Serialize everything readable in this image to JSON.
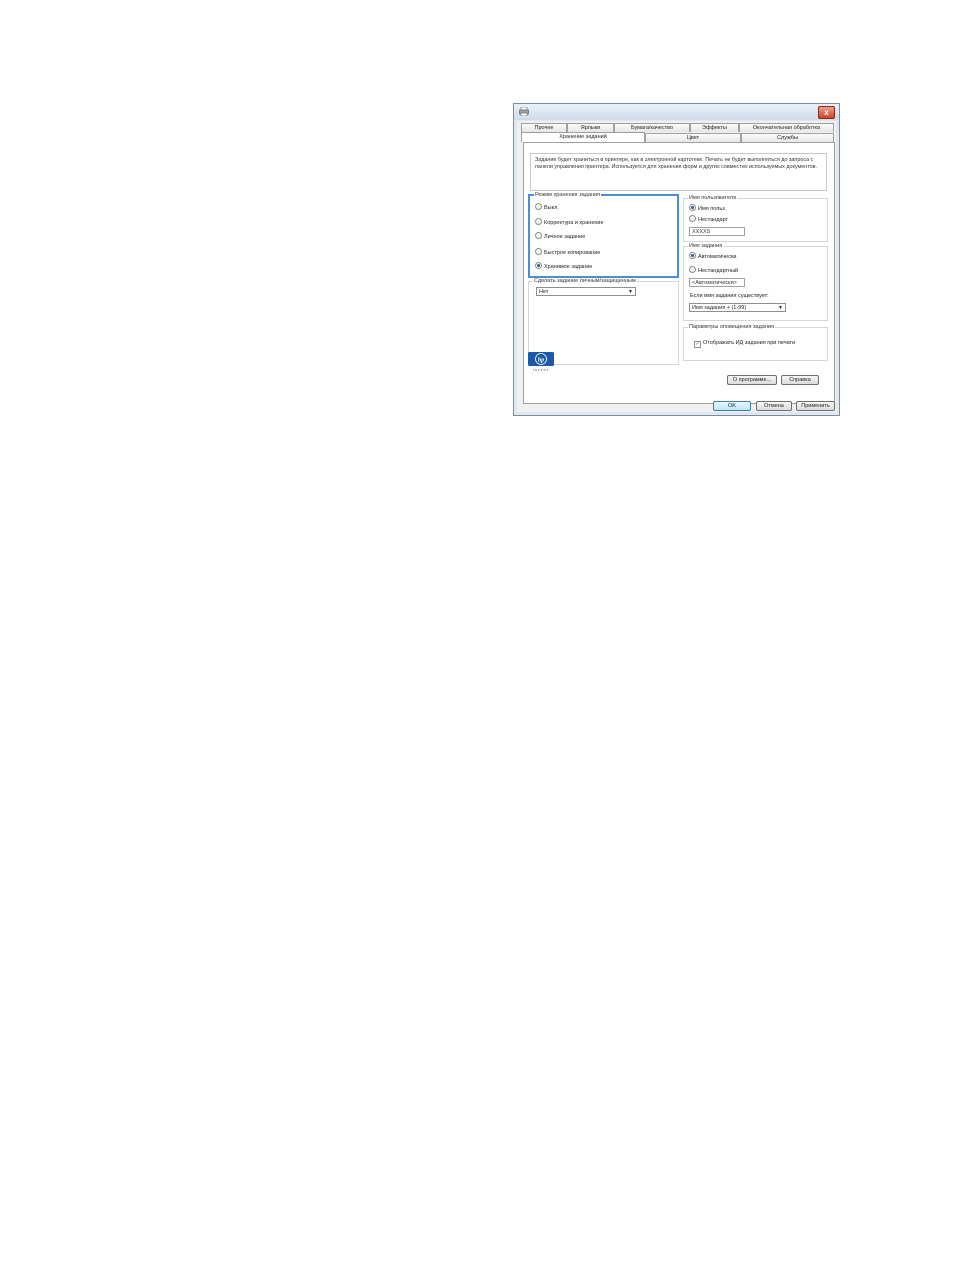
{
  "dialog": {
    "close_glyph": "x"
  },
  "tabs_row1": [
    "Прочее",
    "Ярлыки",
    "Бумага/качество",
    "Эффекты",
    "Окончательная обработка"
  ],
  "tabs_row2": [
    "Хранение заданий",
    "Цвет",
    "Службы"
  ],
  "active_tab": "Хранение заданий",
  "description": "Задание будет храниться в принтере, как в электронной картотеке. Печать не будет выполняться до запроса с панели управления принтера. Используется для хранения форм и других совместно используемых документов.",
  "storage_mode": {
    "legend": "Режим хранения задания",
    "options": [
      {
        "label": "Выкл.",
        "selected": false
      },
      {
        "label": "Корректура и хранение",
        "selected": false
      },
      {
        "label": "Личное задание",
        "selected": false
      },
      {
        "label": "Быстрое копирование",
        "selected": false
      },
      {
        "label": "Хранимое задание",
        "selected": true
      }
    ]
  },
  "private": {
    "legend": "Сделать задание личным/защищенным",
    "value": "Нет"
  },
  "user_name": {
    "legend": "Имя пользователя",
    "options": [
      {
        "label": "Имя польз.",
        "selected": true
      },
      {
        "label": "Нестандарт",
        "selected": false
      }
    ],
    "value": "XXXXS"
  },
  "job_name": {
    "legend": "Имя задания",
    "options": [
      {
        "label": "Автоматически",
        "selected": true
      },
      {
        "label": "Нестандартный",
        "selected": false
      }
    ],
    "value": "<Автоматически>",
    "exists_label": "Если имя задания существует:",
    "exists_value": "Имя задания + (1-99)"
  },
  "notify": {
    "legend": "Параметры оповещения задания",
    "checkbox_label": "Отображать ИД задания при печати",
    "checked": true
  },
  "buttons": {
    "about": "О программе...",
    "help": "Справка",
    "ok": "OK",
    "cancel": "Отмена",
    "apply": "Применить"
  },
  "logo": {
    "text": "hp",
    "subtext": "invent"
  },
  "colors": {
    "highlight": "#4a8fd6",
    "hp_blue": "#1a5aa8"
  }
}
